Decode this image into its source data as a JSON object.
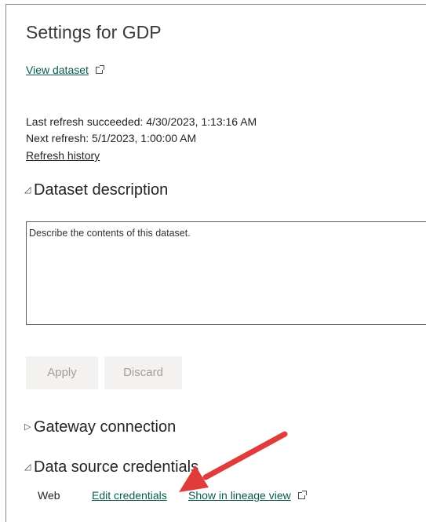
{
  "page": {
    "title": "Settings for GDP",
    "view_dataset_label": "View dataset",
    "last_refresh": "Last refresh succeeded: 4/30/2023, 1:13:16 AM",
    "next_refresh": "Next refresh: 5/1/2023, 1:00:00 AM",
    "refresh_history_label": "Refresh history"
  },
  "description_section": {
    "title": "Dataset description",
    "toggle_icon": "triangle-expanded",
    "placeholder": "Describe the contents of this dataset.",
    "value": "",
    "apply_label": "Apply",
    "discard_label": "Discard"
  },
  "gateway_section": {
    "title": "Gateway connection",
    "toggle_icon": "triangle-collapsed"
  },
  "credentials_section": {
    "title": "Data source credentials",
    "toggle_icon": "triangle-expanded",
    "source_type": "Web",
    "edit_label": "Edit credentials",
    "lineage_label": "Show in lineage view"
  },
  "colors": {
    "link": "#0b5a4f",
    "annotation_arrow": "#e03c3c",
    "disabled_button_bg": "#f3f2f1",
    "disabled_button_text": "#a19f9d"
  }
}
